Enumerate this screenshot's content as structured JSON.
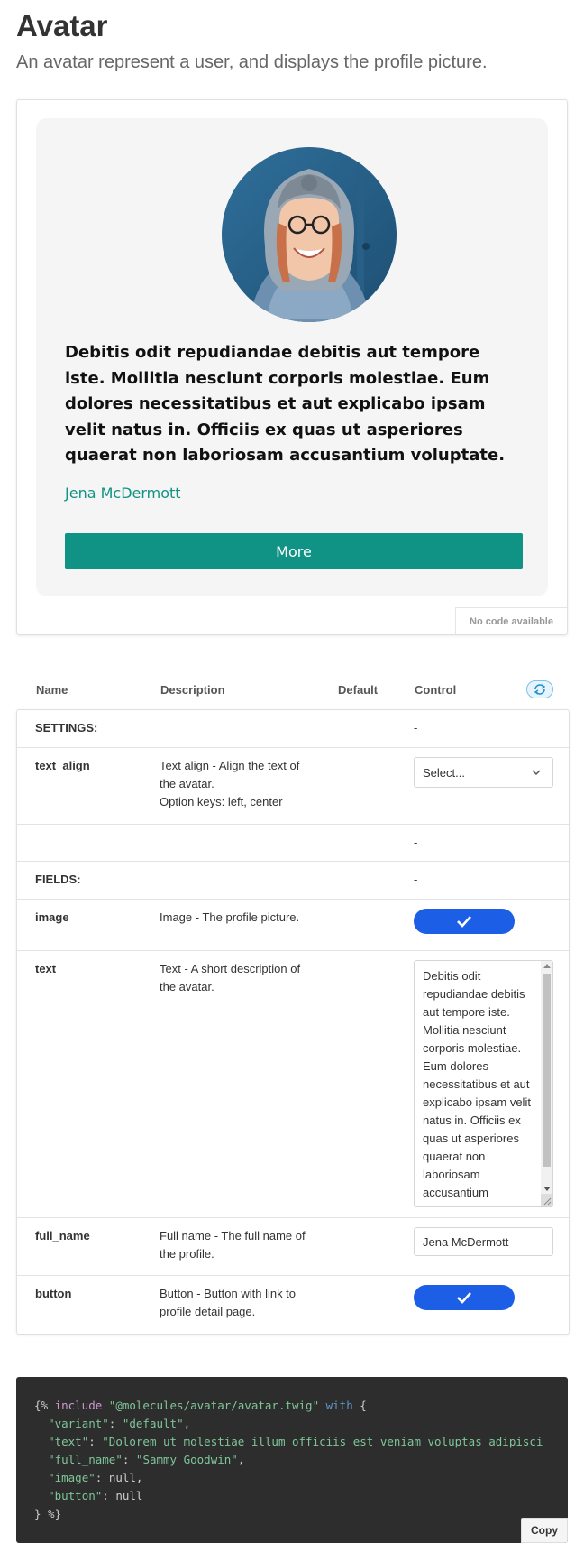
{
  "page": {
    "title": "Avatar",
    "subtitle": "An avatar represent a user, and displays the profile picture."
  },
  "preview": {
    "avatar_text": "Debitis odit repudiandae debitis aut tempore iste. Mollitia nesciunt corporis molestiae. Eum dolores necessitatibus et aut explicabo ipsam velit natus in. Officiis ex quas ut asperiores quaerat non laboriosam accusantium voluptate.",
    "full_name": "Jena McDermott",
    "button_label": "More",
    "no_code_label": "No code available",
    "accent_color": "#109384"
  },
  "props": {
    "headers": {
      "name": "Name",
      "description": "Description",
      "default": "Default",
      "control": "Control"
    },
    "rows": {
      "settings": {
        "name": "SETTINGS:",
        "control": "-"
      },
      "text_align": {
        "name": "text_align",
        "description": "Text align - Align the text of the avatar.",
        "option_keys": "Option keys: left, center",
        "select_value": "Select..."
      },
      "spacer": {
        "control": "-"
      },
      "fields": {
        "name": "FIELDS:",
        "control": "-"
      },
      "image": {
        "name": "image",
        "description": "Image - The profile picture.",
        "toggle_on": true
      },
      "text": {
        "name": "text",
        "description": "Text - A short description of the avatar.",
        "value": "Debitis odit repudiandae debitis aut tempore iste. Mollitia nesciunt corporis molestiae. Eum dolores necessitatibus et aut explicabo ipsam velit natus in. Officiis ex quas ut asperiores quaerat non laboriosam accusantium voluptate."
      },
      "full_name": {
        "name": "full_name",
        "description": "Full name - The full name of the profile.",
        "value": "Jena McDermott"
      },
      "button": {
        "name": "button",
        "description": "Button - Button with link to profile detail page.",
        "toggle_on": true
      }
    },
    "toggle_color": "#1c5ee6"
  },
  "code": {
    "line1_open": "{% ",
    "line1_kw": "include",
    "line1_path": "\"@molecules/avatar/avatar.twig\"",
    "line1_with": "with",
    "line1_brace": "{",
    "variant_key": "\"variant\"",
    "variant_val": "\"default\"",
    "text_key": "\"text\"",
    "text_val": "\"Dolorem ut molestiae illum officiis est veniam voluptas adipisci",
    "full_name_key": "\"full_name\"",
    "full_name_val": "\"Sammy Goodwin\"",
    "image_key": "\"image\"",
    "image_val": "null",
    "button_key": "\"button\"",
    "button_val": "null",
    "close": "} %}",
    "copy_label": "Copy"
  }
}
